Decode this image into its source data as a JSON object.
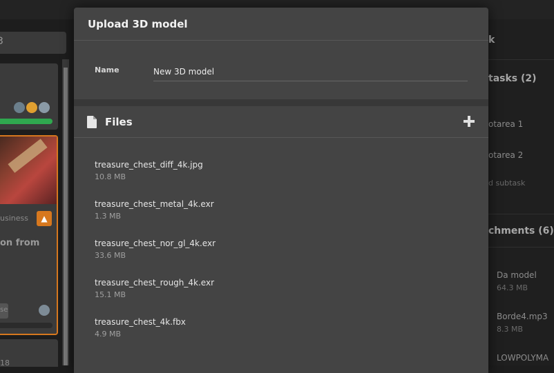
{
  "modal": {
    "title": "Upload 3D model",
    "name_label": "Name",
    "name_value": "New 3D model",
    "files_title": "Files",
    "files": [
      {
        "name": "treasure_chest_diff_4k.jpg",
        "size": "10.8 MB"
      },
      {
        "name": "treasure_chest_metal_4k.exr",
        "size": "1.3 MB"
      },
      {
        "name": "treasure_chest_nor_gl_4k.exr",
        "size": "33.6 MB"
      },
      {
        "name": "treasure_chest_rough_4k.exr",
        "size": "15.1 MB"
      },
      {
        "name": "treasure_chest_4k.fbx",
        "size": "4.9 MB"
      }
    ]
  },
  "background": {
    "search_partial": "3",
    "card_category_partial": "usiness",
    "card_title_partial": "on from",
    "card_tag_partial": "se",
    "bottom_partial": "18",
    "right_header_partial": "k",
    "subtasks_header": "tasks (2)",
    "subtasks": [
      "otarea 1",
      "otarea 2"
    ],
    "add_subtask": "d subtask",
    "attachments_header": "chments (6)",
    "attachments": [
      {
        "name": "Da model",
        "size": "64.3 MB"
      },
      {
        "name": "Borde4.mp3",
        "size": "8.3 MB"
      },
      {
        "name": "LOWPOLYMA",
        "size": ""
      }
    ]
  },
  "colors": {
    "modal_bg": "#444444",
    "accent_orange": "#d7781e",
    "progress_green": "#2fa84f"
  }
}
